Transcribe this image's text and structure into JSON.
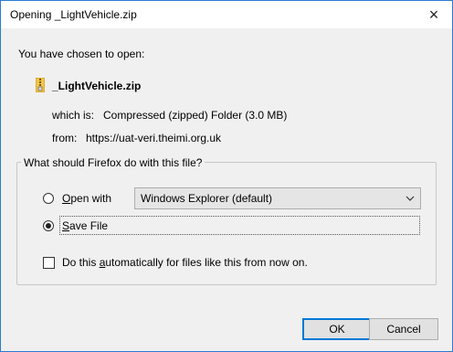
{
  "dialog": {
    "title": "Opening _LightVehicle.zip",
    "close_symbol": "×"
  },
  "file": {
    "chosen_text": "You have chosen to open:",
    "icon": "zip-folder-icon",
    "name": "_LightVehicle.zip",
    "which_label": "which is:",
    "which_value": "Compressed (zipped) Folder (3.0 MB)",
    "from_label": "from:",
    "from_value": "https://uat-veri.theimi.org.uk"
  },
  "action": {
    "legend": "What should Firefox do with this file?",
    "open_with": {
      "prefix": "",
      "accel": "O",
      "rest": "pen with",
      "selected": false
    },
    "app_select": {
      "value": "Windows Explorer (default)"
    },
    "save_file": {
      "accel": "S",
      "rest": "ave File",
      "selected": true
    },
    "auto": {
      "prefix": "Do this ",
      "accel": "a",
      "rest": "utomatically for files like this from now on.",
      "checked": false
    }
  },
  "buttons": {
    "ok": "OK",
    "cancel": "Cancel"
  },
  "colors": {
    "dialog_border": "#2b7bd3",
    "dialog_bg": "#f0f0f0",
    "ok_focus": "#0078d7"
  }
}
